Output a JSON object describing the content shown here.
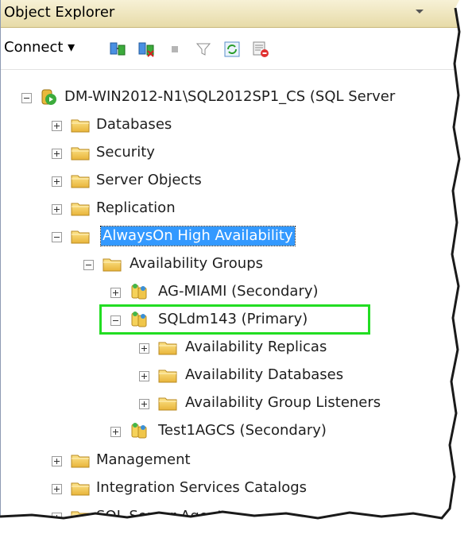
{
  "header": {
    "title": "Object Explorer"
  },
  "toolbar": {
    "connect_label": "Connect ▾"
  },
  "tree": {
    "server": "DM-WIN2012-N1\\SQL2012SP1_CS (SQL Server",
    "databases": "Databases",
    "security": "Security",
    "server_objects": "Server Objects",
    "replication": "Replication",
    "alwayson": "AlwaysOn High Availability",
    "availability_groups": "Availability Groups",
    "ag_miami": "AG-MIAMI (Secondary)",
    "sqldm143": "SQLdm143 (Primary)",
    "availability_replicas": "Availability Replicas",
    "availability_databases": "Availability Databases",
    "availability_group_listeners": "Availability Group Listeners",
    "test1agcs": "Test1AGCS (Secondary)",
    "management": "Management",
    "integration_services": "Integration Services Catalogs",
    "sql_server_agent": "SQL Server Agent"
  },
  "colors": {
    "selection": "#3399ff",
    "highlight_box": "#22dd22",
    "folder": "#f0c64a"
  }
}
